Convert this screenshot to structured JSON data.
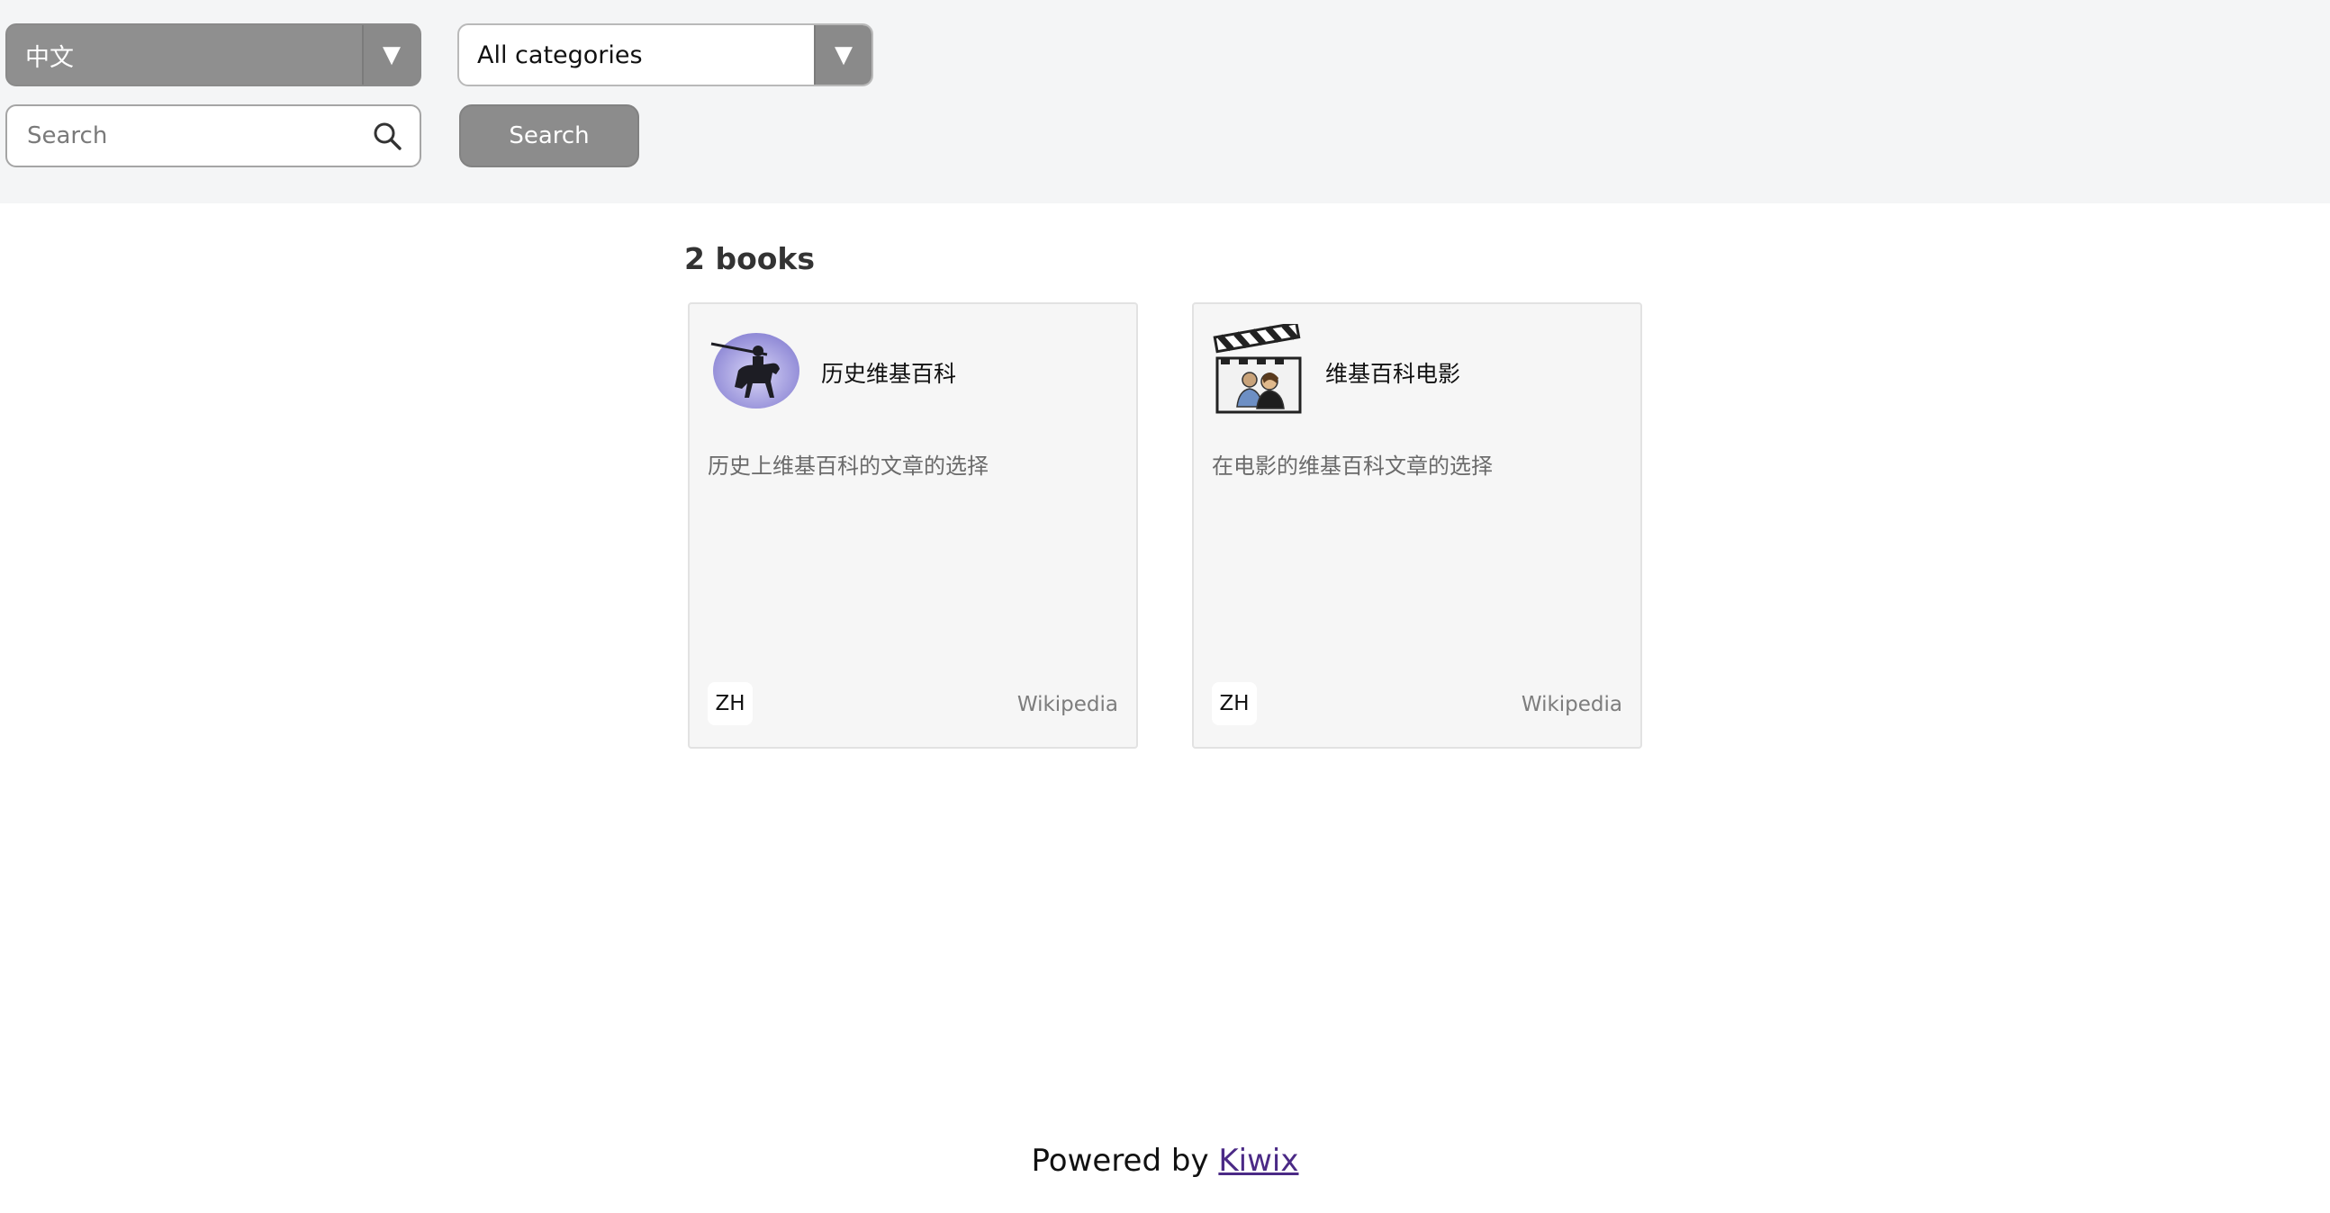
{
  "filters": {
    "language_selected": "中文",
    "category_selected": "All categories",
    "search_placeholder": "Search",
    "search_button_label": "Search"
  },
  "results": {
    "count_label": "2 books",
    "books": [
      {
        "title": "历史维基百科",
        "description": "历史上维基百科的文章的选择",
        "language": "ZH",
        "publisher": "Wikipedia",
        "thumbnail_icon": "horseman-statue-icon"
      },
      {
        "title": "维基百科电影",
        "description": "在电影的维基百科文章的选择",
        "language": "ZH",
        "publisher": "Wikipedia",
        "thumbnail_icon": "film-clapperboard-icon"
      }
    ]
  },
  "footer": {
    "powered_by_text": "Powered by",
    "link_label": "Kiwix"
  },
  "colors": {
    "topbar_bg": "#f4f5f6",
    "button_gray": "#8c8c8c",
    "card_bg": "#f6f6f6",
    "link_color": "#4b2a86"
  }
}
